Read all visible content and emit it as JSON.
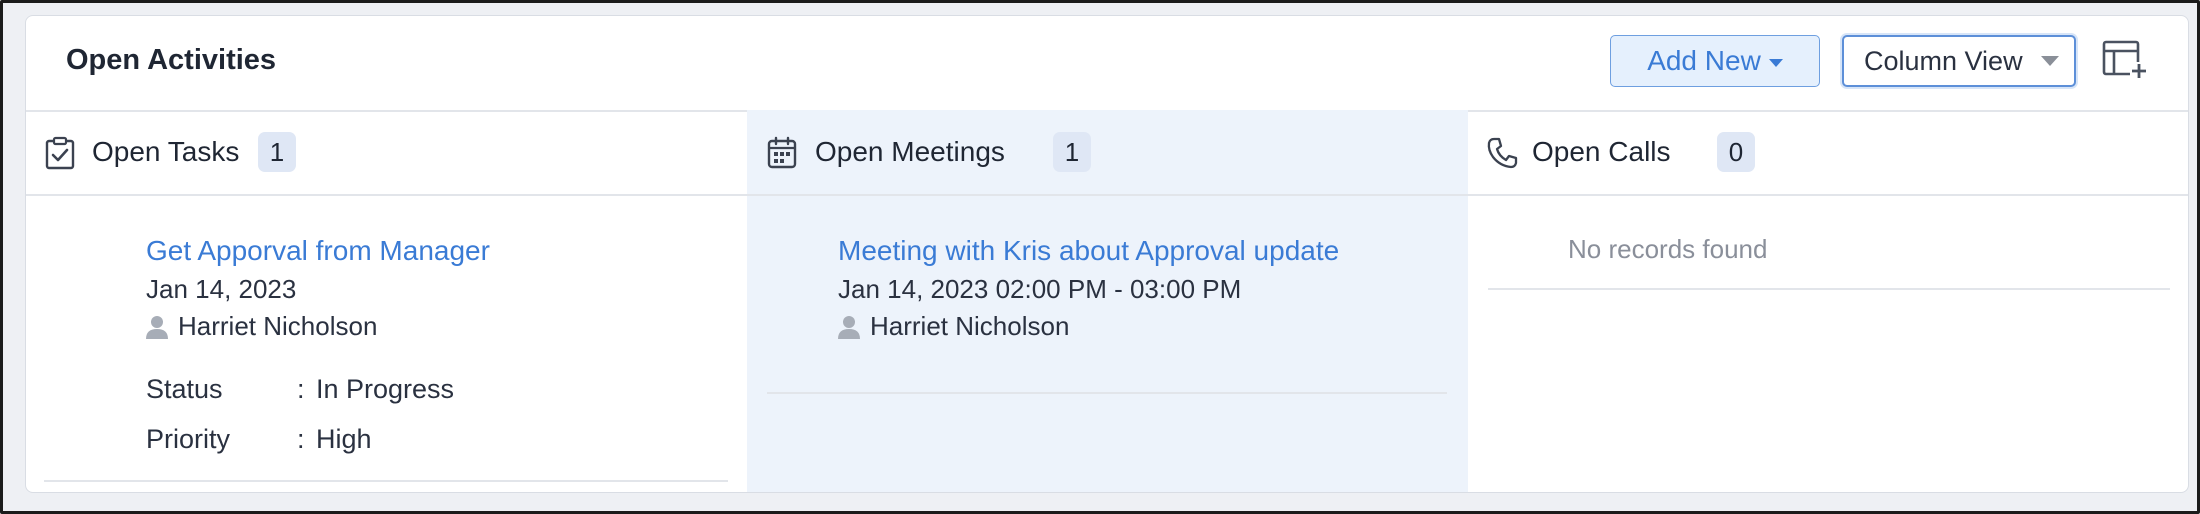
{
  "header": {
    "title": "Open Activities",
    "add_new_label": "Add New",
    "view_select": "Column View"
  },
  "columns": [
    {
      "title": "Open Tasks",
      "count": "1",
      "icon": "task-check-icon",
      "records": [
        {
          "subject": "Get Apporval from Manager",
          "date": "Jan 14, 2023",
          "owner": "Harriet Nicholson",
          "fields": [
            {
              "label": "Status",
              "value": "In Progress"
            },
            {
              "label": "Priority",
              "value": "High"
            }
          ]
        }
      ]
    },
    {
      "title": "Open Meetings",
      "count": "1",
      "icon": "calendar-icon",
      "records": [
        {
          "subject": "Meeting with Kris about Approval update",
          "date": "Jan 14, 2023 02:00 PM - 03:00 PM",
          "owner": "Harriet Nicholson"
        }
      ]
    },
    {
      "title": "Open Calls",
      "count": "0",
      "icon": "phone-icon",
      "empty_text": "No records found"
    }
  ],
  "colors": {
    "accent": "#3a7bd5",
    "meetings_bg": "#edf3fb",
    "badge_bg": "#dfe7f5"
  }
}
